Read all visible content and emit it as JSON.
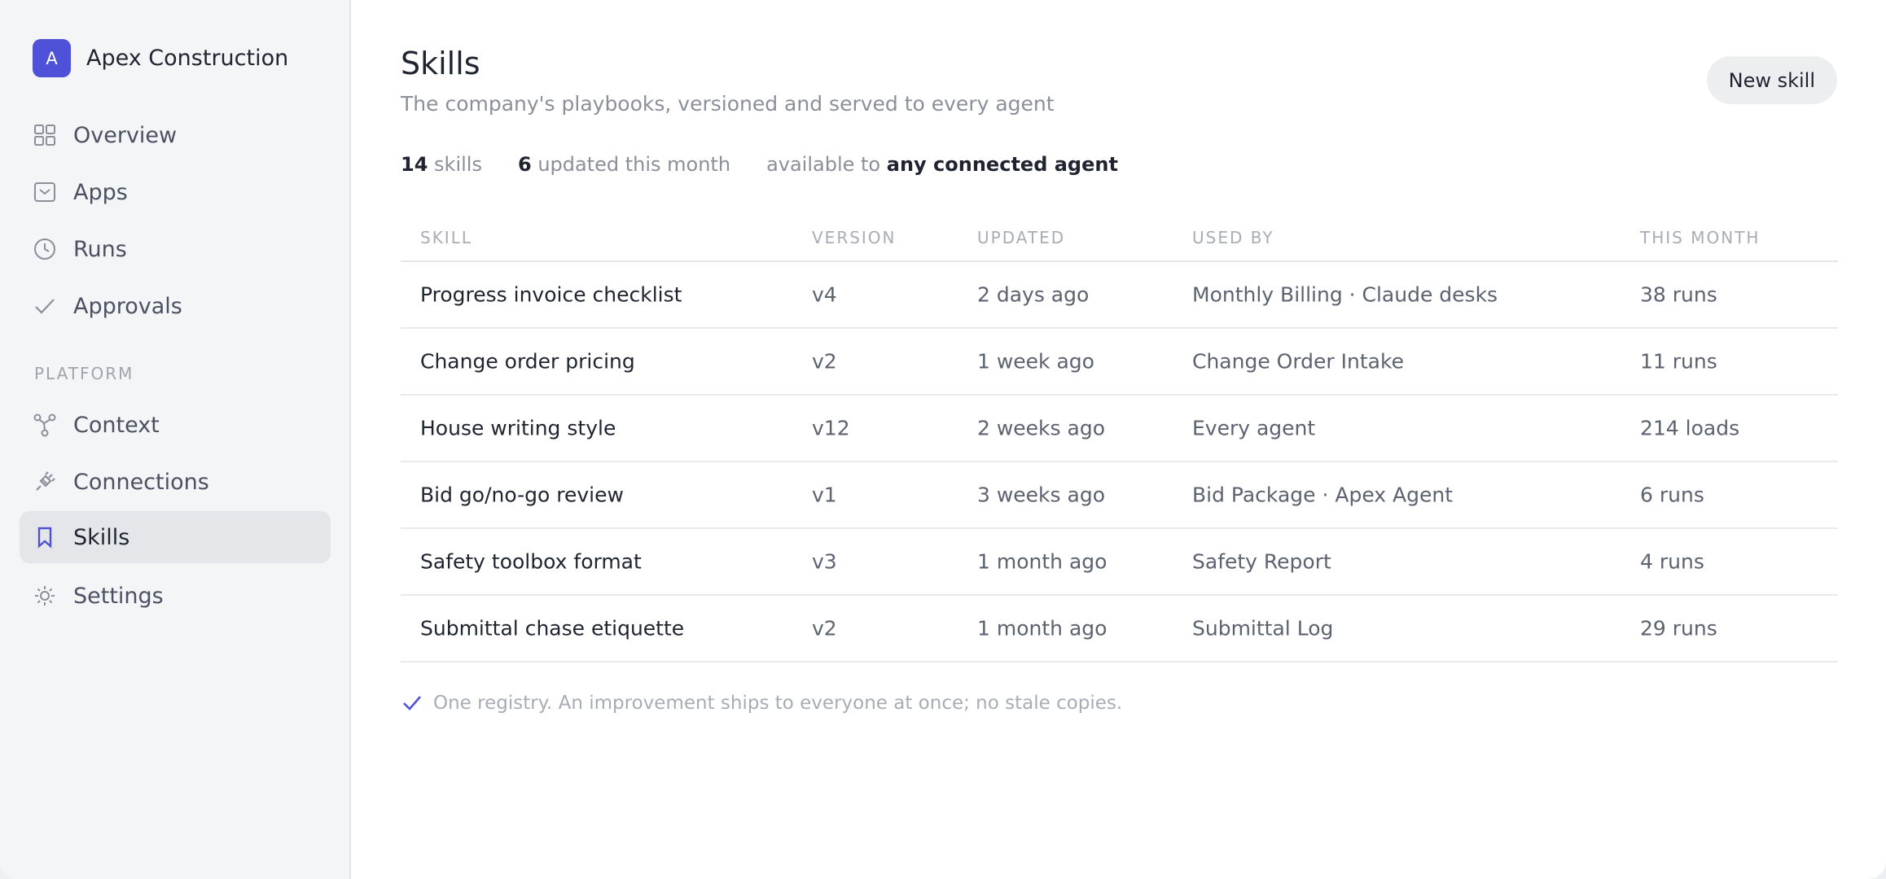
{
  "brand": {
    "logo_letter": "A",
    "name": "Apex Construction",
    "accent": "#4f52d8"
  },
  "sidebar": {
    "items": [
      {
        "label": "Overview",
        "icon": "grid-icon"
      },
      {
        "label": "Apps",
        "icon": "inbox-icon"
      },
      {
        "label": "Runs",
        "icon": "clock-icon"
      },
      {
        "label": "Approvals",
        "icon": "check-icon"
      }
    ],
    "section_label": "PLATFORM",
    "platform_items": [
      {
        "label": "Context",
        "icon": "graph-icon"
      },
      {
        "label": "Connections",
        "icon": "plug-icon"
      },
      {
        "label": "Skills",
        "icon": "bookmark-icon",
        "active": true
      },
      {
        "label": "Settings",
        "icon": "sun-icon"
      }
    ]
  },
  "header": {
    "title": "Skills",
    "subtitle": "The company's playbooks, versioned and served to every agent",
    "new_button": "New skill"
  },
  "stats": {
    "skills_count": "14",
    "skills_label": "skills",
    "updated_count": "6",
    "updated_label": "updated this month",
    "available_prefix": "available to",
    "available_target": "any connected agent"
  },
  "table": {
    "columns": [
      "SKILL",
      "VERSION",
      "UPDATED",
      "USED BY",
      "THIS MONTH"
    ],
    "rows": [
      {
        "skill": "Progress invoice checklist",
        "version": "v4",
        "updated": "2 days ago",
        "used_by": "Monthly Billing · Claude desks",
        "this_month": "38 runs"
      },
      {
        "skill": "Change order pricing",
        "version": "v2",
        "updated": "1 week ago",
        "used_by": "Change Order Intake",
        "this_month": "11 runs"
      },
      {
        "skill": "House writing style",
        "version": "v12",
        "updated": "2 weeks ago",
        "used_by": "Every agent",
        "this_month": "214 loads"
      },
      {
        "skill": "Bid go/no-go review",
        "version": "v1",
        "updated": "3 weeks ago",
        "used_by": "Bid Package · Apex Agent",
        "this_month": "6 runs"
      },
      {
        "skill": "Safety toolbox format",
        "version": "v3",
        "updated": "1 month ago",
        "used_by": "Safety Report",
        "this_month": "4 runs"
      },
      {
        "skill": "Submittal chase etiquette",
        "version": "v2",
        "updated": "1 month ago",
        "used_by": "Submittal Log",
        "this_month": "29 runs"
      }
    ]
  },
  "footnote": "One registry. An improvement ships to everyone at once; no stale copies."
}
